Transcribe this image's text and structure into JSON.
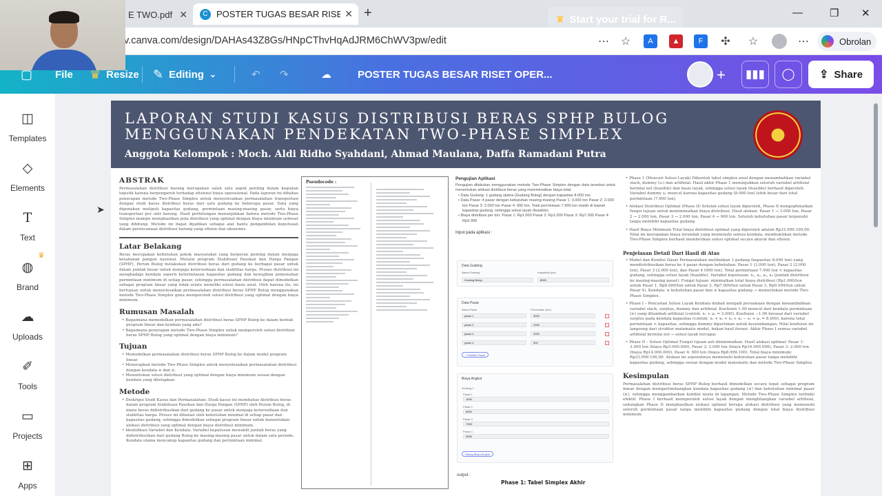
{
  "browser": {
    "tabs": [
      {
        "label": "E TWO.pdf"
      },
      {
        "label": "POSTER TUGAS BESAR RISET OPER"
      }
    ],
    "url": "v.canva.com/design/DAHAs43Z8Gs/HNpCThvHqAdJRM6ChWV3pw/edit",
    "copilot_label": "Obrolan"
  },
  "canva": {
    "file_label": "File",
    "resize_label": "Resize",
    "editing_label": "Editing",
    "doc_title": "POSTER TUGAS BESAR RISET OPER...",
    "trial_label": "Start your trial for R...",
    "share_label": "Share"
  },
  "sidebar": {
    "items": [
      {
        "label": "Templates",
        "icon": "templates-icon"
      },
      {
        "label": "Elements",
        "icon": "elements-icon"
      },
      {
        "label": "Text",
        "icon": "text-icon"
      },
      {
        "label": "Brand",
        "icon": "brand-icon"
      },
      {
        "label": "Uploads",
        "icon": "uploads-icon"
      },
      {
        "label": "Tools",
        "icon": "tools-icon"
      },
      {
        "label": "Projects",
        "icon": "projects-icon"
      },
      {
        "label": "Apps",
        "icon": "apps-icon"
      }
    ]
  },
  "poster": {
    "title_line1": "LAPORAN STUDI KASUS DISTRIBUSI BERAS SPHP BULOG",
    "title_line2": "MENGGUNAKAN PENDEKATAN TWO-PHASE SIMPLEX",
    "members": "Anggota Kelompok : Moch. Aldi Ridho Syahdani, Ahmad Maulana, Daffa Ramadani Putra",
    "abstrak_h": "ABSTRAK",
    "abstrak_text": "Permasalahan distribusi barang merupakan salah satu aspek penting dalam kegiatan logistik karena berpengaruh terhadap efisiensi biaya operasional. Pada laporan ini dibahas penerapan metode Two-Phase Simplex untuk menyelesaikan permasalahan transportasi dengan studi kasus distribusi beras dari satu gudang ke beberapa pasar. Data yang digunakan meliputi kapasitas gudang, permintaan masing-masing pasar, serta biaya transportasi per unit barang. Hasil perhitungan menunjukkan bahwa metode Two-Phase Simplex mampu menghasilkan pola distribusi yang optimal dengan biaya minimum sebesar yang dihitung. Metode ini dapat dijadikan sebagai alat bantu pengambilan keputusan dalam perencanaan distribusi barang yang efisien dan ekonomis.",
    "latar_h": "Latar Belakang",
    "latar_text": "Beras merupakan kebutuhan pokok masyarakat yang berperan penting dalam menjaga ketahanan pangan nasional. Melalui program Stabilisasi Pasokan dan Harga Pangan (SPHP), Perum Bulog melakukan distribusi beras dari gudang ke berbagai pasar untuk dalam jumlah besar untuk menjaga ketersediaan dan stabilitas harga. Proses distribusi ini menghadapi kendala seperti keterbatasan kapasitas gudang dan kewajiban pemenuhan permintaan minimum di setiap pasar, sehingga permasalahan distribusi dapat dimodelkan sebagai program linear yang tidak selalu memiliki solusi basis awal. Oleh karena itu, ini bertujuan untuk menyelesaikan permasalahan distribusi beras SPHP Bulog menggunakan metode Two-Phase Simplex guna memperoleh solusi distribusi yang optimal dengan biaya minimum.",
    "rumusan_h": "Rumusan Masalah",
    "rumusan_items": [
      "Bagaimana memodelkan permasalahan distribusi beras SPHP Bulog ke dalam bentuk program linear dan kendala yang ada?",
      "Bagaimana penerapan metode Two-Phase Simplex untuk memperoleh solusi distribusi beras SPHP Bulog yang optimal dengan biaya minimum?"
    ],
    "tujuan_h": "Tujuan",
    "tujuan_items": [
      "Memodelkan permasalahan distribusi beras SPHP Bulog ke dalam model program linear.",
      "Menerapkan metode Two-Phase Simplex untuk menyelesaikan permasalahan distribusi dengan kendala ≥ dan ≤.",
      "Menentukan solusi distribusi yang optimal dengan biaya minimum sesuai dengan kendala yang ditetapkan."
    ],
    "metode_h": "Metode",
    "metode_items": [
      "Deskripsi Studi Kasus dan Permasalahan: Studi kasus ini membahas distribusi beras dalam program Stabilisasi Pasokan dan Harga Pangan (SPHP) oleh Perum Bulog, di mana beras didistribusikan dari gudang ke pasar untuk menjaga ketersediaan dan stabilitas harga. Proses ini dibatasi oleh kebutuhan minimal di setiap pasar dan kapasitas gudang, sehingga dimodelkan sebagai program linear untuk menentukan alokasi distribusi yang optimal dengan biaya distribusi minimum.",
      "Identifikasi Variabel dan Kendala: Variabel keputusan mewakili jumlah beras yang didistribusikan dari gudang Bulog ke masing-masing pasar untuk dalam satu periode. Kendala utama mencakup kapasitas gudang dan permintaan minimal."
    ],
    "pseudocode_h": "Pseudocode :",
    "pengujian_h": "Pengujian Aplikasi",
    "pengujian_text": "Pengujian dilakukan menggunakan metode Two-Phase Simplex dengan data tersebut untuk menentukan alokasi distribusi beras yang meminimalkan biaya total.",
    "pengujian_items": [
      "Data Gudang: 1 gudang utama (Gudang Bulog) dengan kapasitas 8.000 ton.",
      "Data Pasar: 4 pasar dengan kebutuhan masing-masing Pasar 1: 3.000 ton Pasar 2: 2.000 ton Pasar 3: 2.000 ton Pasar 4: 900 ton. Total permintaan 7.900 ton masih di bawah kapasitas gudang, sehingga solusi layak (feasible).",
      "Biaya distribusi per ton: Pasar 1: Rp1.000 Pasar 2: Rp1.000 Pasar 3: Rp7.000 Pasar 4: Rp9.999"
    ],
    "input_label": "Input pada aplikasi :",
    "app_cards": {
      "gudang_title": "Data Gudang",
      "gudang_col1": "Nama Gudang",
      "gudang_col2": "Kapasitas (ton)",
      "gudang_name": "Gudang Bulog",
      "gudang_cap": "8000",
      "pasar_title": "Data Pasar",
      "pasar_col1": "Nama Pasar",
      "pasar_col2": "Permintaan (ton)",
      "pasar_rows": [
        {
          "name": "pasar 1",
          "val": "3000"
        },
        {
          "name": "pasar 2",
          "val": "2000"
        },
        {
          "name": "pasar 3",
          "val": "2000"
        },
        {
          "name": "pasar 4",
          "val": "900"
        }
      ],
      "tambah_btn": "+ Tambah Pasar",
      "biaya_title": "Biaya Angkut",
      "biaya_sub": "Gudang 1",
      "biaya_rows": [
        {
          "label": "Pasar 1",
          "val": "1000"
        },
        {
          "label": "Pasar 2",
          "val": "8000"
        },
        {
          "label": "Pasar 3",
          "val": "7000"
        },
        {
          "label": "Pasar 4",
          "val": "9999"
        }
      ],
      "hitung_btn": "Hitung Biaya Angkut"
    },
    "output_label": "output :",
    "phase1_label": "Phase 1: Tabel Simplex Akhir",
    "col4_items": [
      "Phase 1 (Mencari Solusi Layak) Dibentuk tabel simplex awal dengan menambahkan variabel slack, dummy (s₁) dan artifisial. Hasil akhir Phase 1 menunjukkan seluruh variabel artifisial bernilai nol (feasible) dan basis layak, sehingga solusi layak (feasible) berhasil diperoleh. Variabel dummy s₁ muncul karena kapasitas gudang (8.000 ton) lebih besar dari total permintaan (7.900 ton).",
      "Alokasi Distribusi Optimal (Phase II) Setelah solusi layak diperoleh, Phase II mengoptimalkan fungsi tujuan untuk meminimalkan biaya distribusi. Hasil alokasi: Pasar 1 → 3.000 ton, Pasar 2 → 2.000 ton, Pasar 3 → 2.000 ton, Pasar 4 → 900 ton. Seluruh kebutuhan pasar terpenuhi tanpa melebihi kapasitas gudang.",
      "Hasil Biaya Minimum Total biaya distribusi optimal yang diperoleh adalah Rp33.999.100,00. Nilai ini merupakan biaya terendah yang memenuhi semua kendala, membuktikan metode Two-Phase Simplex berhasil memberikan solusi optimal secara akurat dan efisien."
    ],
    "penjelasan_h": "Penjelasan Detail Dari Hasil di Atas",
    "penjelasan_items": [
      "Model dan Kondisi Dasar Permasalahan melibatkan 1 gudang (kapasitas 8.000 ton) yang mendistribusikan beras ke 4 pasar dengan kebutuhan: Pasar 1 (3.000 ton), Pasar 2 (2.000 ton), Pasar 3 (2.000 ton), dan Pasar 4 (900 ton). Total permintaan 7.900 ton < kapasitas gudang, sehingga solusi layak (feasible). Variabel keputusan: x₁, x₂, x₃, x₄ (jumlah distribusi ke masing-masing pasar). Fungsi tujuan: minimalkan total biaya distribusi (Rp1.000/ton untuk Pasar 1, Rp8.000/ton untuk Pasar 2, Rp7.000/ton untuk Pasar 3, Rp9.999/ton untuk Pasar 4). Kendala: ≥ kebutuhan pasar dan ≤ kapasitas gudang → memerlukan metode Two-Phase Simplex.",
      "Phase I – Pencarian Solusi Layak Kendala diubah menjadi persamaan dengan menambahkan variabel slack, surplus, dummy dan artifisial. Koefisien 1.00 muncul dari kendala permintaan (≥) yang ditambah artifisial (contoh: x₁ + a₁ = 3.000). Koefisien −1.00 berasal dari variabel surplus pada kendala kapasitas (contoh: x₁ + x₂ + x₃ + x₄ − s₁ + a₅ = 8.000), karena total permintaan < kapasitas, sehingga dummy diperlukan untuk keseimbangan. Nilai koefisien ini langsung dari struktur matematis model, bukan hasil iterasi. Akhir Phase I semua variabel artifisial bernilai nol → solusi layak tercapai.",
      "Phase II – Solusi Optimal Fungsi tujuan asli diminimalkan. Hasil alokasi optimal: Pasar 1: 3.000 ton (biaya Rp3.000.000), Pasar 2: 2.000 ton (biaya Rp16.000.000), Pasar 3: 2.000 ton (biaya Rp14.000.000), Pasar 4: 900 ton (biaya Rp8.999.100). Total biaya minimum: Rp33.999.100,00. Alokasi ini sepenuhnya memenuhi kebutuhan pasar tanpa melebihi kapasitas gudang, sehingga sesuai dengan model matematis dan metode Two-Phase Simplex."
    ],
    "kesimpulan_h": "Kesimpulan",
    "kesimpulan_text": "Permasalahan distribusi beras SPHP Bulog berhasil dimodelkan secara tepat sebagai program linear dengan mempertimbangkan kendala kapasitas gudang (≤) dan kebutuhan minimal pasar (≥), sehingga menggambarkan kondisi nyata di lapangan. Metode Two-Phase Simplex terbukti efektif. Phase I berhasil memperoleh solusi layak dengan menghilangkan variabel artifisial, sedangkan Phase II menghasilkan alokasi optimal berupa alokasi distribusi yang memenuhi seluruh permintaan pasar tanpa melebihi kapasitas gudang dengan total biaya distribusi minimum."
  },
  "colors": {
    "header_bg": "#4d5670",
    "canva_grad_start": "#14b3c7",
    "canva_grad_end": "#7a4ce8"
  }
}
